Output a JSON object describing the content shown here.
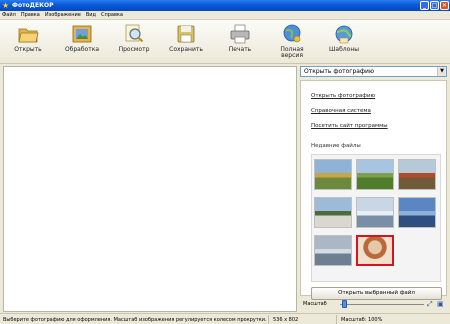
{
  "window": {
    "title": "ФотоДЕКОР",
    "buttons": {
      "minimize": "_",
      "maximize": "□",
      "close": "✕"
    }
  },
  "menu": {
    "items": [
      "Файл",
      "Правка",
      "Изображение",
      "Вид",
      "Справка"
    ]
  },
  "toolbar": {
    "open": "Открыть",
    "process": "Обработка",
    "preview": "Просмотр",
    "save": "Сохранить",
    "print": "Печать",
    "full_version_line1": "Полная",
    "full_version_line2": "версия",
    "templates": "Шаблоны"
  },
  "panel": {
    "combo_value": "Открыть фотографию",
    "links": [
      "Открыть фотографию",
      "Справочная система",
      "Посетить сайт программы"
    ],
    "recent_title": "Недавние файлы",
    "open_selected": "Открыть выбранный файл",
    "thumbnails": [
      {
        "name": "field-trees",
        "colors": [
          "#8fb3d6",
          "#6d8a3c",
          "#c9a44a"
        ]
      },
      {
        "name": "green-meadow",
        "colors": [
          "#a7c4e0",
          "#4f7d2c",
          "#7ea04a"
        ]
      },
      {
        "name": "autumn-house",
        "colors": [
          "#b7c9d8",
          "#6f5a3a",
          "#b04a2a"
        ]
      },
      {
        "name": "church-domes",
        "colors": [
          "#9dbad8",
          "#d8d8d0",
          "#4d6a38"
        ]
      },
      {
        "name": "winter-lake",
        "colors": [
          "#c9d6e4",
          "#7a8ea8",
          "#e8eef4"
        ]
      },
      {
        "name": "blue-river",
        "colors": [
          "#5b86c4",
          "#2f4f80",
          "#8fb0d8"
        ]
      },
      {
        "name": "grey-sea",
        "colors": [
          "#aab8c6",
          "#6d7f90",
          "#d4dbe2"
        ]
      },
      {
        "name": "portrait-girl",
        "colors": [
          "#e4c8a8",
          "#b86a3a",
          "#f2e0cc"
        ],
        "selected": true
      }
    ]
  },
  "zoom": {
    "label": "Масштаб",
    "level": 0.05
  },
  "status": {
    "hint": "Выберите фотографию для оформления. Масштаб изображения регулируется колесом прокрутки.",
    "dimensions": "536 x 802",
    "zoom_text": "Масштаб: 100%"
  },
  "colors": {
    "titlebar": "#0a58d6",
    "accent": "#2457b0",
    "selection": "#d4141e"
  }
}
